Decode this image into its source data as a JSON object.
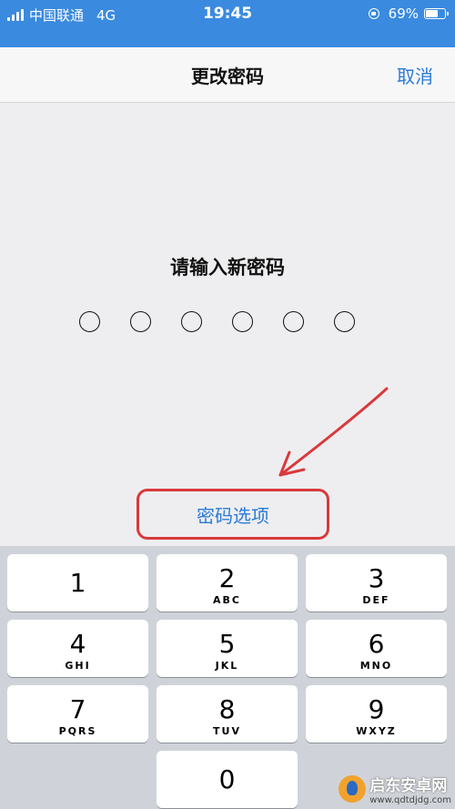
{
  "status_bar": {
    "carrier": "中国联通",
    "network": "4G",
    "time": "19:45",
    "battery": "69%",
    "battery_level": 0.69,
    "icons": [
      "signal-icon",
      "rotation-lock-icon",
      "battery-icon"
    ]
  },
  "nav": {
    "title": "更改密码",
    "cancel_label": "取消"
  },
  "main": {
    "prompt": "请输入新密码",
    "passcode_length": 6,
    "options_label": "密码选项"
  },
  "keypad": {
    "keys": [
      {
        "digit": "1",
        "letters": ""
      },
      {
        "digit": "2",
        "letters": "ABC"
      },
      {
        "digit": "3",
        "letters": "DEF"
      },
      {
        "digit": "4",
        "letters": "GHI"
      },
      {
        "digit": "5",
        "letters": "JKL"
      },
      {
        "digit": "6",
        "letters": "MNO"
      },
      {
        "digit": "7",
        "letters": "PQRS"
      },
      {
        "digit": "8",
        "letters": "TUV"
      },
      {
        "digit": "9",
        "letters": "WXYZ"
      },
      {
        "digit": "0",
        "letters": ""
      }
    ]
  },
  "watermark": {
    "name": "启东安卓网",
    "url": "www.qdtdjdg.com"
  },
  "colors": {
    "status_bar": "#3a8ae0",
    "link_blue": "#2a7bd6",
    "annotation_red": "#d9393c",
    "keypad_bg": "#cfd3d9"
  }
}
